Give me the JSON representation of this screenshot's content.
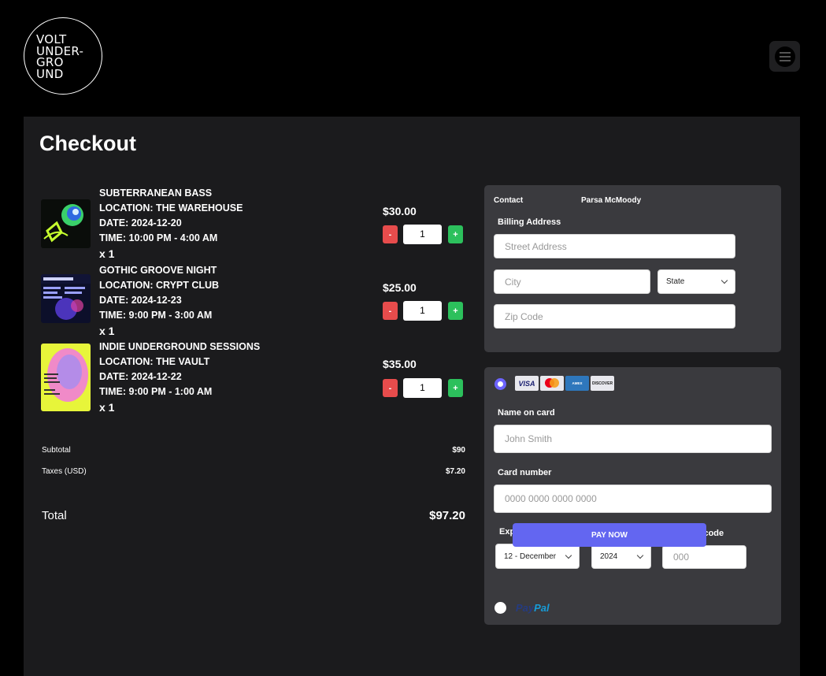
{
  "logo": {
    "text": "VOLT\nUNDER-\nGRO\nUND"
  },
  "page_title": "Checkout",
  "items": [
    {
      "name": "SUBTERRANEAN BASS",
      "location": "LOCATION: THE WAREHOUSE",
      "date": "DATE: 2024-12-20",
      "time": "TIME: 10:00 PM - 4:00 AM",
      "qty_text": "x 1",
      "price": "$30.00",
      "qty": "1",
      "minus": "-",
      "plus": "+"
    },
    {
      "name": "GOTHIC GROOVE NIGHT",
      "location": "LOCATION: CRYPT CLUB",
      "date": "DATE: 2024-12-23",
      "time": "TIME: 9:00 PM - 3:00 AM",
      "qty_text": "x 1",
      "price": "$25.00",
      "qty": "1",
      "minus": "-",
      "plus": "+"
    },
    {
      "name": "INDIE UNDERGROUND SESSIONS",
      "location": "LOCATION: THE VAULT",
      "date": "DATE: 2024-12-22",
      "time": "TIME: 9:00 PM - 1:00 AM",
      "qty_text": "x 1",
      "price": "$35.00",
      "qty": "1",
      "minus": "-",
      "plus": "+"
    }
  ],
  "summary": {
    "subtotal_label": "Subtotal",
    "subtotal": "$90",
    "taxes_label": "Taxes (USD)",
    "taxes": "$7.20",
    "total_label": "Total",
    "total": "$97.20"
  },
  "contact": {
    "label": "Contact",
    "name": "Parsa McMoody"
  },
  "billing": {
    "label": "Billing Address",
    "street_placeholder": "Street Address",
    "city_placeholder": "City",
    "state": "State",
    "zip_placeholder": "Zip Code"
  },
  "card": {
    "brands": [
      "VISA",
      "MasterCard",
      "AMERICAN EXPRESS",
      "DISCOVER"
    ],
    "name_label": "Name on card",
    "name_placeholder": "John Smith",
    "number_label": "Card number",
    "number_placeholder": "0000 0000 0000 0000",
    "exp_label": "Expiration date",
    "exp_month": "12 - December",
    "exp_year": "2024",
    "cvc_label": "Security code",
    "cvc_placeholder": "000"
  },
  "paypal": {
    "part1": "Pay",
    "part2": "Pal"
  },
  "pay_button": "PAY NOW",
  "colors": {
    "accent": "#6366f1",
    "minus": "#e74c4c",
    "plus": "#2cc05c",
    "panel": "#1b1b1d",
    "box": "#3a3a3e"
  }
}
